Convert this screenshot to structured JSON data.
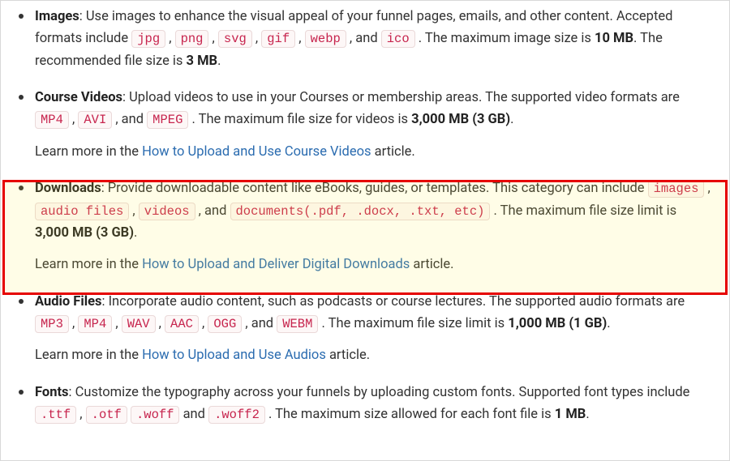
{
  "sections": {
    "images": {
      "title": "Images",
      "desc1": ": Use images to enhance the visual appeal of your funnel pages, emails, and other content. Accepted formats include ",
      "formats": [
        "jpg",
        "png",
        "svg",
        "gif",
        "webp"
      ],
      "and": " , and ",
      "lastFormat": "ico",
      "desc2": " . The maximum image size is ",
      "max": "10 MB",
      "desc3": ". The recommended file size is ",
      "rec": "3 MB",
      "period": "."
    },
    "videos": {
      "title": "Course Videos",
      "desc1": ": Upload videos to use in your Courses or membership areas. The supported video formats are ",
      "formats": [
        "MP4",
        "AVI"
      ],
      "and": " , and ",
      "lastFormat": "MPEG",
      "desc2": " . The maximum file size for videos is ",
      "max": "3,000 MB (3 GB)",
      "period": ".",
      "learn": "Learn more in the ",
      "link": "How to Upload and Use Course Videos",
      "articleSuffix": " article."
    },
    "downloads": {
      "title": "Downloads",
      "desc1": ": Provide downloadable content like eBooks, guides, or templates. This category can include ",
      "formats": [
        "images",
        "audio files",
        "videos"
      ],
      "and": " , and ",
      "lastFormat": "documents(.pdf, .docx, .txt, etc)",
      "desc2": " . The maximum file size limit is ",
      "max": "3,000 MB (3 GB)",
      "period": ".",
      "learn": "Learn more in the ",
      "link": "How to Upload and Deliver Digital Downloads",
      "articleSuffix": " article."
    },
    "audio": {
      "title": "Audio Files",
      "desc1": ": Incorporate audio content, such as podcasts or course lectures. The supported audio formats are ",
      "formats": [
        "MP3",
        "MP4",
        "WAV",
        "AAC",
        "OGG"
      ],
      "and": " , and ",
      "lastFormat": "WEBM",
      "desc2": " . The maximum file size limit is ",
      "max": "1,000 MB (1 GB)",
      "period": ".",
      "learn": "Learn more in the ",
      "link": "How to Upload and Use Audios",
      "articleSuffix": " article."
    },
    "fonts": {
      "title": "Fonts",
      "desc1": ": Customize the typography across your funnels by uploading custom fonts. Supported font types include ",
      "formats": [
        ".ttf",
        ".otf",
        ".woff"
      ],
      "sep": " , ",
      "and": " and ",
      "lastFormat": ".woff2",
      "desc2": " . The maximum size allowed for each font file is ",
      "max": "1 MB",
      "period": "."
    }
  },
  "comma": " , "
}
